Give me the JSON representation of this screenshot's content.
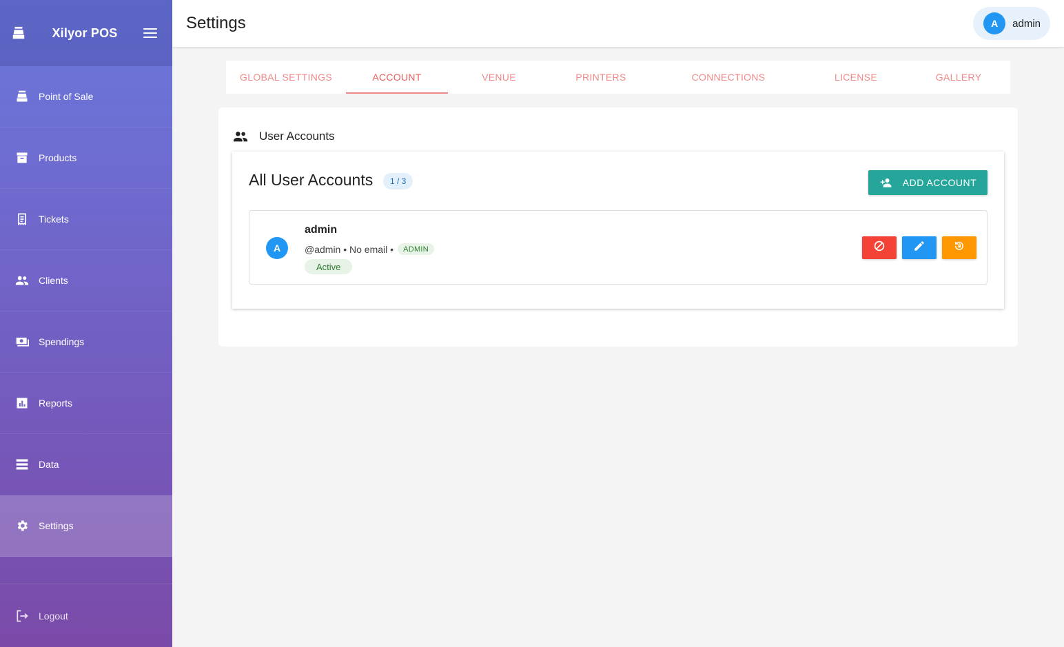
{
  "app": {
    "name": "Xilyor POS"
  },
  "sidebar": {
    "items": [
      {
        "label": "Point of Sale",
        "icon": "cash-register-icon"
      },
      {
        "label": "Products",
        "icon": "archive-icon"
      },
      {
        "label": "Tickets",
        "icon": "receipt-icon"
      },
      {
        "label": "Clients",
        "icon": "people-icon"
      },
      {
        "label": "Spendings",
        "icon": "money-icon"
      },
      {
        "label": "Reports",
        "icon": "bar-chart-icon"
      },
      {
        "label": "Data",
        "icon": "storage-icon"
      },
      {
        "label": "Settings",
        "icon": "gear-icon",
        "active": true
      }
    ],
    "logout_label": "Logout"
  },
  "header": {
    "title": "Settings",
    "user": {
      "initial": "A",
      "name": "admin"
    }
  },
  "tabs": [
    {
      "label": "GLOBAL SETTINGS"
    },
    {
      "label": "ACCOUNT",
      "active": true
    },
    {
      "label": "VENUE"
    },
    {
      "label": "PRINTERS"
    },
    {
      "label": "CONNECTIONS"
    },
    {
      "label": "LICENSE"
    },
    {
      "label": "GALLERY"
    }
  ],
  "section": {
    "title": "User Accounts",
    "list_title": "All User Accounts",
    "count": "1 / 3",
    "add_button": "ADD ACCOUNT"
  },
  "accounts": [
    {
      "initial": "A",
      "name": "admin",
      "meta": "@admin • No email •",
      "role": "ADMIN",
      "status": "Active"
    }
  ],
  "colors": {
    "primary": "#2196f3",
    "teal": "#26a69a",
    "danger": "#f44336",
    "warning": "#ff9800",
    "tab": "#ef8a8a"
  }
}
